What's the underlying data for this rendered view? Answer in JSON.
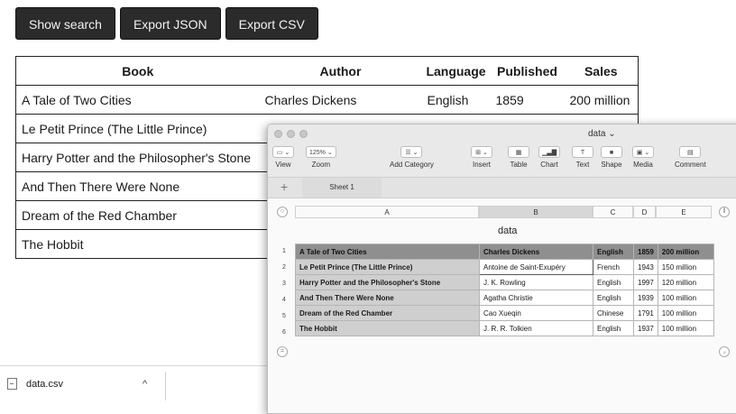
{
  "toolbar": {
    "show_search": "Show search",
    "export_json": "Export JSON",
    "export_csv": "Export CSV"
  },
  "web_table": {
    "headers": [
      "Book",
      "Author",
      "Language",
      "Published",
      "Sales"
    ],
    "rows": [
      [
        "A Tale of Two Cities",
        "Charles Dickens",
        "English",
        "1859",
        "200 million"
      ],
      [
        "Le Petit Prince (The Little Prince)",
        "",
        "",
        "",
        ""
      ],
      [
        "Harry Potter and the Philosopher's Stone",
        "",
        "",
        "",
        ""
      ],
      [
        "And Then There Were None",
        "",
        "",
        "",
        ""
      ],
      [
        "Dream of the Red Chamber",
        "",
        "",
        "",
        ""
      ],
      [
        "The Hobbit",
        "",
        "",
        "",
        ""
      ]
    ]
  },
  "downloads": {
    "file_name": "data.csv",
    "caret": "^"
  },
  "numbers": {
    "window_title": "data ⌄",
    "tools": {
      "view": "View",
      "zoom": "Zoom",
      "zoom_value": "125% ⌄",
      "add_category": "Add Category",
      "insert": "Insert",
      "table": "Table",
      "chart": "Chart",
      "text": "Text",
      "shape": "Shape",
      "media": "Media",
      "comment": "Comment"
    },
    "sheet_tab": "Sheet 1",
    "columns": [
      "A",
      "B",
      "C",
      "D",
      "E"
    ],
    "table_title": "data",
    "row_numbers": [
      "1",
      "2",
      "3",
      "4",
      "5",
      "6"
    ],
    "rows": [
      [
        "A Tale of Two Cities",
        "Charles Dickens",
        "English",
        "1859",
        "200 million"
      ],
      [
        "Le Petit Prince (The Little Prince)",
        "Antoine de Saint-Exupéry",
        "French",
        "1943",
        "150 million"
      ],
      [
        "Harry Potter and the Philosopher's Stone",
        "J. K. Rowling",
        "English",
        "1997",
        "120 million"
      ],
      [
        "And Then There Were None",
        "Agatha Christie",
        "English",
        "1939",
        "100 million"
      ],
      [
        "Dream of the Red Chamber",
        "Cao Xueqin",
        "Chinese",
        "1791",
        "100 million"
      ],
      [
        "The Hobbit",
        "J. R. R. Tolkien",
        "English",
        "1937",
        "100 million"
      ]
    ]
  }
}
